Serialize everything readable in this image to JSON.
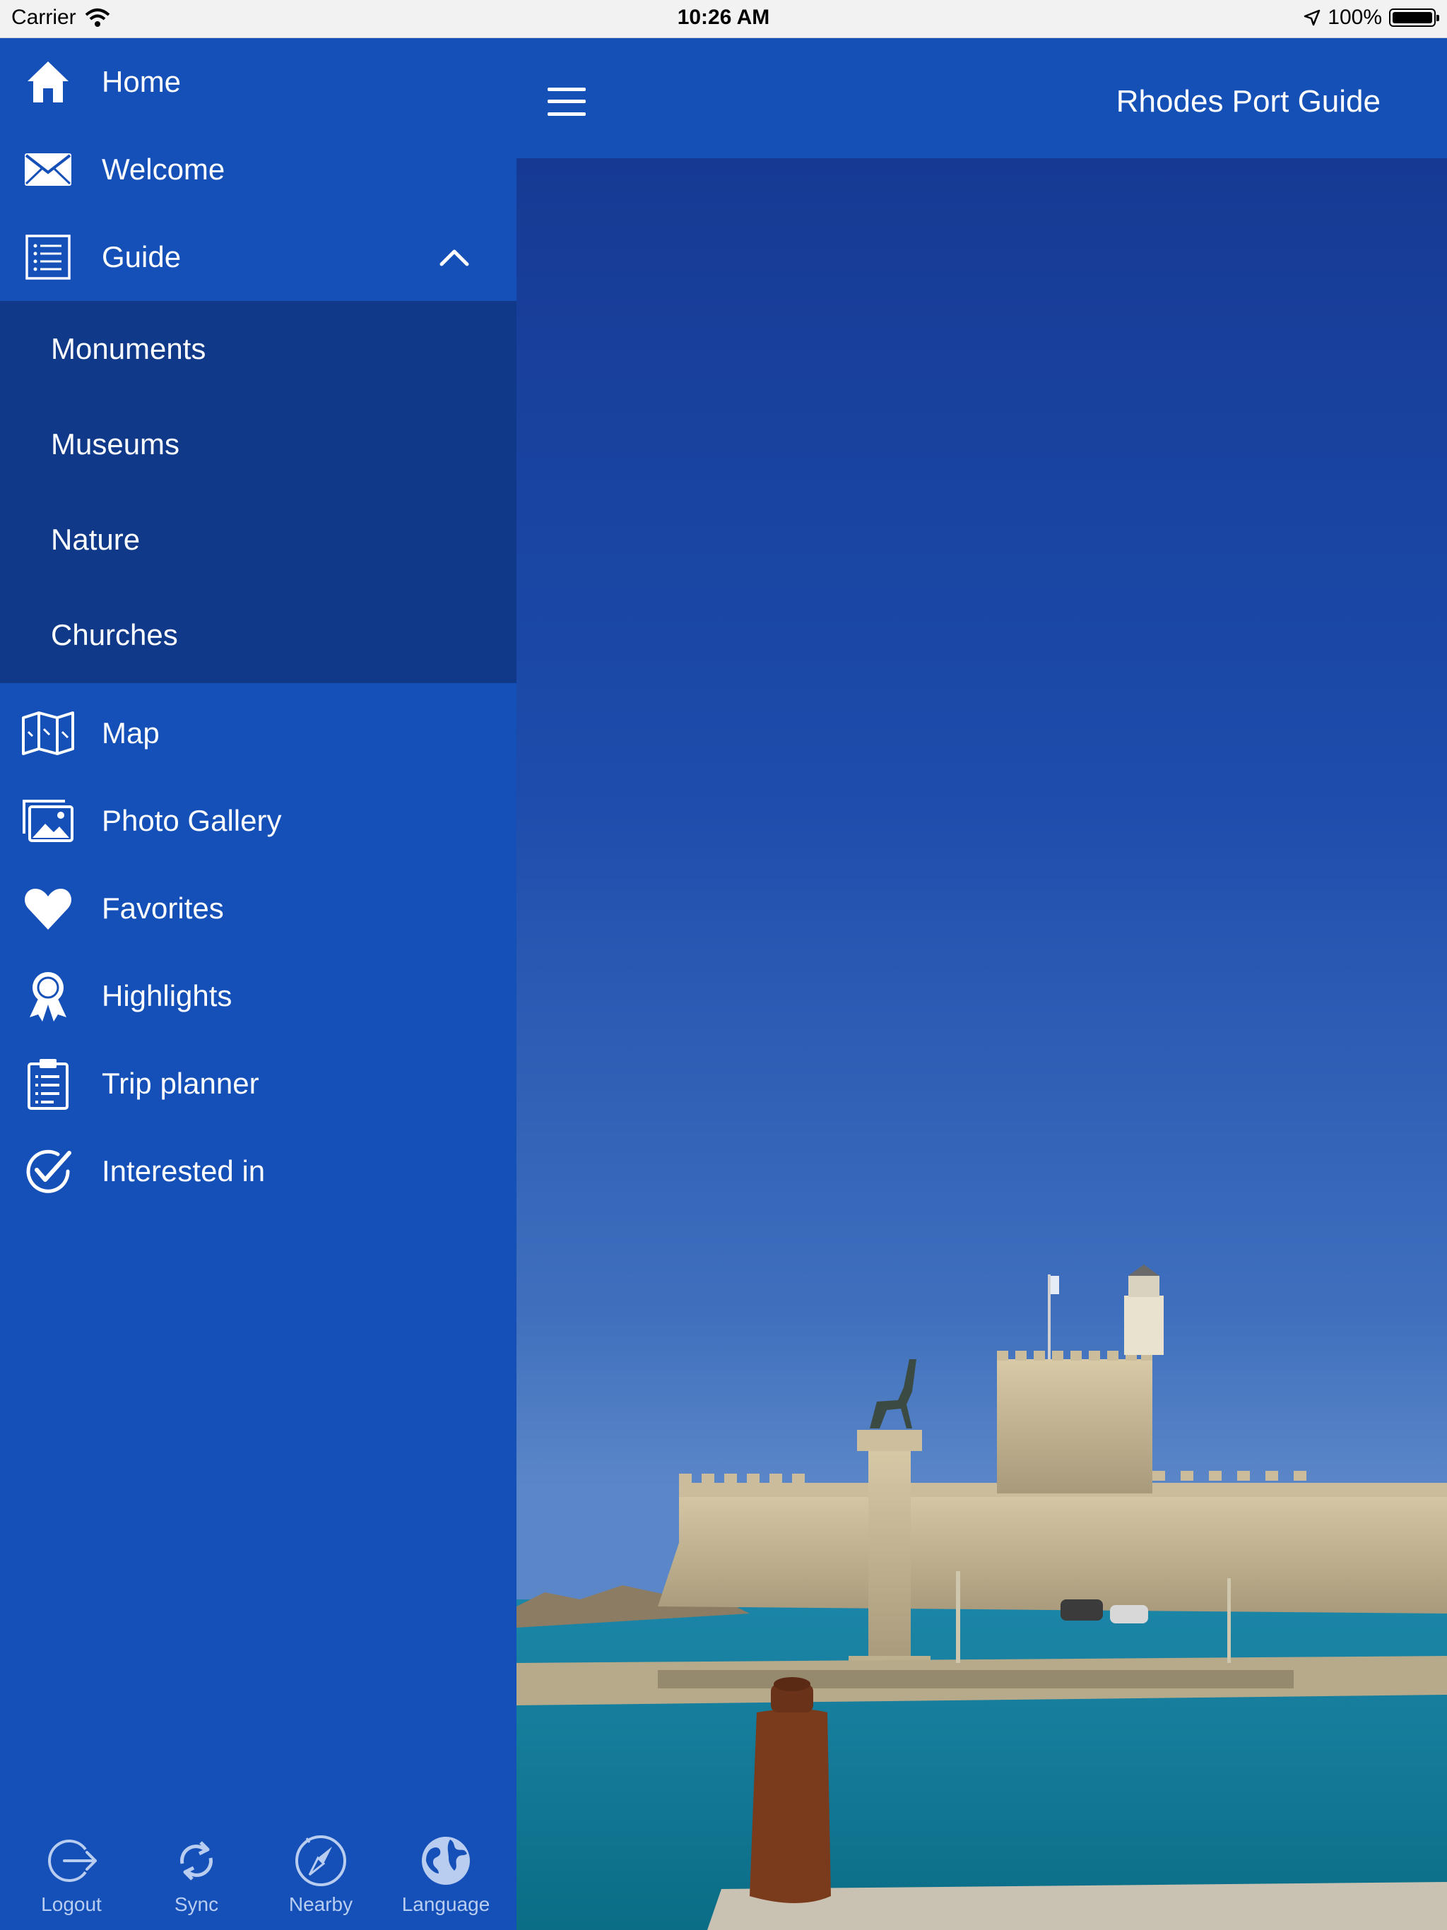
{
  "status_bar": {
    "carrier": "Carrier",
    "time": "10:26 AM",
    "battery": "100%",
    "battery_level": 1.0
  },
  "app": {
    "title": "Rhodes Port Guide",
    "menu_icon": "hamburger-icon"
  },
  "sidebar": {
    "items": [
      {
        "label": "Home",
        "icon": "home-icon"
      },
      {
        "label": "Welcome",
        "icon": "envelope-icon"
      },
      {
        "label": "Guide",
        "icon": "list-icon",
        "expanded": true
      },
      {
        "label": "Map",
        "icon": "map-icon"
      },
      {
        "label": "Photo Gallery",
        "icon": "photo-gallery-icon"
      },
      {
        "label": "Favorites",
        "icon": "heart-icon"
      },
      {
        "label": "Highlights",
        "icon": "award-ribbon-icon"
      },
      {
        "label": "Trip planner",
        "icon": "clipboard-icon"
      },
      {
        "label": "Interested in",
        "icon": "check-circle-icon"
      }
    ],
    "guide_submenu": [
      {
        "label": "Monuments"
      },
      {
        "label": "Museums"
      },
      {
        "label": "Nature"
      },
      {
        "label": "Churches"
      }
    ],
    "bottom": [
      {
        "label": "Logout",
        "icon": "logout-icon"
      },
      {
        "label": "Sync",
        "icon": "sync-icon"
      },
      {
        "label": "Nearby",
        "icon": "compass-icon"
      },
      {
        "label": "Language",
        "icon": "globe-icon"
      }
    ]
  },
  "colors": {
    "sidebar_bg": "#1450b8",
    "submenu_bg": "#11398a",
    "topbar_bg": "#1450b6",
    "bottom_label": "#b9cdf0"
  }
}
